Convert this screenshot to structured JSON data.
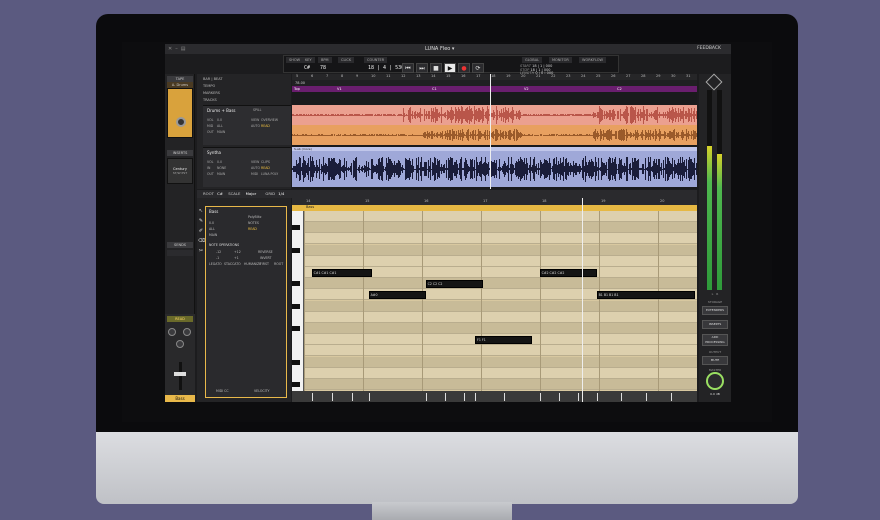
{
  "app": {
    "title": "LUNA Fleo ▾",
    "feedback": "FEEDBACK"
  },
  "transport": {
    "menus": [
      "SHOW",
      "KEY",
      "BPM",
      "CLICK",
      "COUNTER",
      "GLOBAL",
      "MONITOR",
      "WORKFLOW"
    ],
    "key": "C#",
    "bpm": "78",
    "position": "18 | 4 | 530",
    "start_label": "START",
    "start_val": "18 | 1 | 000",
    "stop_label": "STOP",
    "stop_val": "18 | 1 | 000",
    "length_label": "LENGTH",
    "length_val": "0 | 0 | 000"
  },
  "tape": {
    "header": "TAPE",
    "preset": "A. Drums",
    "inserts_header": "INSERTS",
    "insert_name": "Century",
    "insert_sub": "ST/W PST",
    "sends_header": "SENDS",
    "read": "READ",
    "channel_name": "Bass"
  },
  "rows": {
    "bar_beat": "BAR | BEAT",
    "tempo": "TEMPO",
    "markers": "MARKERS",
    "tracks": "TRACKS",
    "tempo_value": "78.00"
  },
  "tracks": [
    {
      "name": "Drums + Bass",
      "kv": [
        [
          "VOL",
          "0.0"
        ],
        [
          "MID",
          "ALL"
        ],
        [
          "OUT",
          "MAIN"
        ],
        [
          "VIEW",
          "OVERVIEW"
        ],
        [
          "AUTO",
          "READ"
        ]
      ],
      "spill": "SPILL",
      "color": "#e8a08c"
    },
    {
      "name": "Syntha",
      "kv": [
        [
          "VOL",
          "0.0"
        ],
        [
          "IN",
          "NONE"
        ],
        [
          "OUT",
          "MAIN"
        ],
        [
          "VIEW",
          "CLIPS"
        ],
        [
          "AUTO",
          "READ"
        ],
        [
          "MIDI",
          "LUNA POLY"
        ]
      ],
      "clip_label": "S-ab (more)",
      "color": "#9fa8d8"
    }
  ],
  "ruler_marks": [
    "5",
    "6",
    "7",
    "8",
    "9",
    "10",
    "11",
    "12",
    "13",
    "14",
    "15",
    "16",
    "17",
    "18",
    "19",
    "20",
    "21",
    "22",
    "23",
    "24",
    "25",
    "26",
    "27",
    "28",
    "29",
    "30",
    "31"
  ],
  "marker_labels": [
    "Top",
    "V1",
    "C1",
    "V2",
    "C2"
  ],
  "editor": {
    "root_label": "ROOT",
    "root": "C#",
    "scale_label": "SCALE",
    "scale": "Major",
    "grid_label": "GRID",
    "grid": "1/4",
    "tracks_label": "TRACKS",
    "scale_tab": "SCALE",
    "fold": "FOLD",
    "bass_track": {
      "name": "Bass",
      "vol": "0.0",
      "in": "ALL",
      "out": "MAIN",
      "edit": "PolyBlitz",
      "view": "NOTES",
      "auto": "READ"
    },
    "note_operations": "NOTE OPERATIONS",
    "ops": [
      "-12",
      "+12",
      "REVERSE",
      "-1",
      "+1",
      "INVERT",
      "LEGATO",
      "STACCATO",
      "HUMANIZE",
      "FIRST",
      "ROOT"
    ],
    "midi_cc": "MIDI CC",
    "velocity": "VELOCITY",
    "ruler": [
      "14",
      "15",
      "16",
      "17",
      "18",
      "19",
      "20"
    ],
    "clip_name": "Bass"
  },
  "notes": [
    {
      "label": "C#1 C#1 C#1",
      "lane": 5,
      "start": 0.02,
      "len": 0.16
    },
    {
      "label": "A#0",
      "lane": 7,
      "start": 0.17,
      "len": 0.15
    },
    {
      "label": "C2 C2 C2",
      "lane": 6,
      "start": 0.32,
      "len": 0.15
    },
    {
      "label": "F1 F1",
      "lane": 11,
      "start": 0.45,
      "len": 0.15
    },
    {
      "label": "C#2 C#2 C#2",
      "lane": 5,
      "start": 0.62,
      "len": 0.15
    },
    {
      "label": "B1 B1 B1 B1",
      "lane": 7,
      "start": 0.77,
      "len": 0.26
    }
  ],
  "meters": {
    "levels": [
      0.72,
      0.68
    ],
    "labels": [
      "L",
      "R"
    ],
    "btns": [
      "EXTENDERS",
      "INSERTS",
      "ADD PROCESSING",
      "MUTE"
    ],
    "storage_lbl": "STORAGE",
    "output_lbl": "OUTPUT",
    "master_value": "0.0 dB",
    "master_lbl": "MASTER"
  },
  "colors": {
    "accent": "#e8b84a",
    "drums_track": "#e8a08c",
    "synth_track": "#9fa8d8",
    "marker_lane": "#6a1e6e",
    "meter_green": "#4fb84f"
  }
}
